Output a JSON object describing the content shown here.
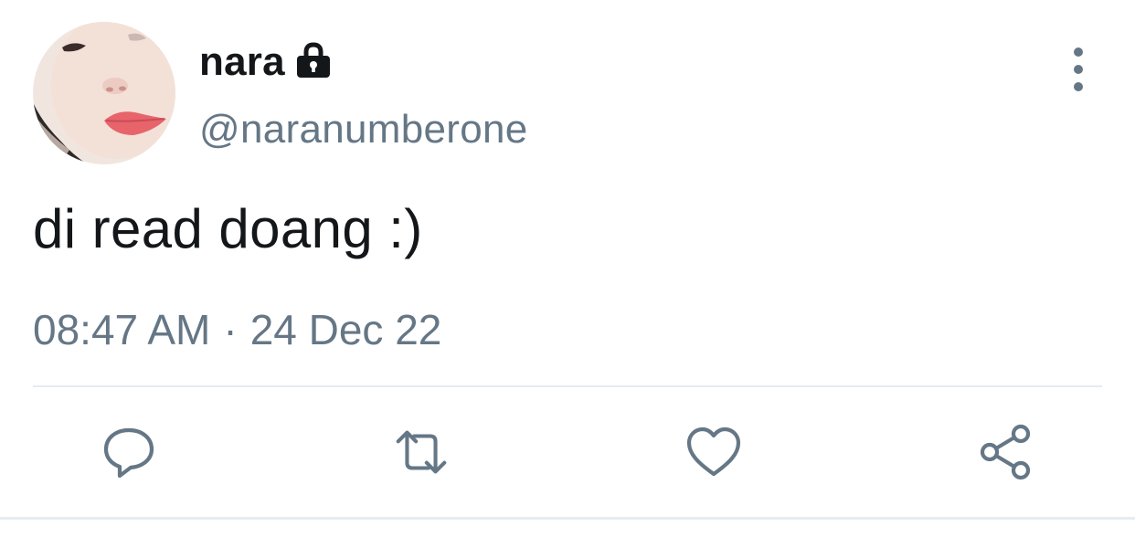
{
  "tweet": {
    "display_name": "nara",
    "handle": "@naranumberone",
    "protected_icon": "lock-icon",
    "text": "di read doang :)",
    "time": "08:47 AM",
    "separator": "·",
    "date": "24 Dec 22",
    "more_icon": "more-vertical-icon"
  },
  "actions": [
    {
      "name": "reply",
      "icon": "reply-icon"
    },
    {
      "name": "retweet",
      "icon": "retweet-icon"
    },
    {
      "name": "like",
      "icon": "heart-icon"
    },
    {
      "name": "share",
      "icon": "share-icon"
    }
  ],
  "colors": {
    "text_primary": "#14171a",
    "text_secondary": "#657786",
    "divider": "#e6ecf0",
    "background": "#ffffff"
  }
}
